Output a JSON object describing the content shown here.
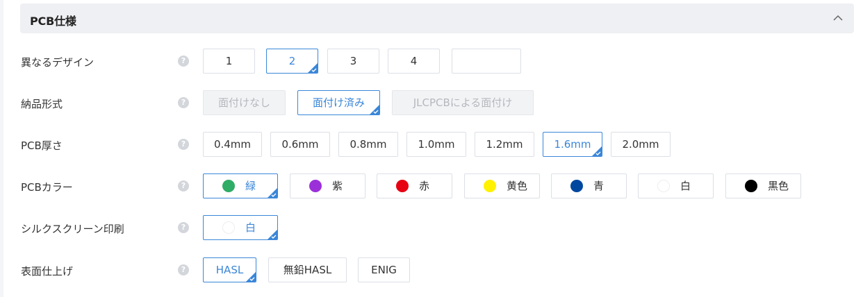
{
  "header": {
    "title": "PCB仕様"
  },
  "rows": {
    "designs": {
      "label": "異なるデザイン",
      "options": [
        "1",
        "2",
        "3",
        "4",
        ""
      ],
      "selected": "2"
    },
    "delivery": {
      "label": "納品形式",
      "options": [
        "面付けなし",
        "面付け済み",
        "JLCPCBによる面付け"
      ],
      "selected": "面付け済み",
      "disabled": [
        "面付けなし",
        "JLCPCBによる面付け"
      ]
    },
    "thickness": {
      "label": "PCB厚さ",
      "options": [
        "0.4mm",
        "0.6mm",
        "0.8mm",
        "1.0mm",
        "1.2mm",
        "1.6mm",
        "2.0mm"
      ],
      "selected": "1.6mm"
    },
    "color": {
      "label": "PCBカラー",
      "options": [
        {
          "label": "緑",
          "color": "#2fac66"
        },
        {
          "label": "紫",
          "color": "#9b30d9"
        },
        {
          "label": "赤",
          "color": "#e60012"
        },
        {
          "label": "黄色",
          "color": "#fff100"
        },
        {
          "label": "青",
          "color": "#0047a0"
        },
        {
          "label": "白",
          "color": "#ffffff"
        },
        {
          "label": "黒色",
          "color": "#000000"
        }
      ],
      "selected": "緑"
    },
    "silkscreen": {
      "label": "シルクスクリーン印刷",
      "options": [
        {
          "label": "白",
          "color": "#ffffff"
        }
      ],
      "selected": "白"
    },
    "finish": {
      "label": "表面仕上げ",
      "options": [
        "HASL",
        "無鉛HASL",
        "ENIG"
      ],
      "selected": "HASL"
    }
  },
  "help_icon": "question-circle-icon",
  "colors": {
    "accent": "#3a86d8",
    "border": "#dcdfe6",
    "header_bg": "#eff0f3"
  }
}
